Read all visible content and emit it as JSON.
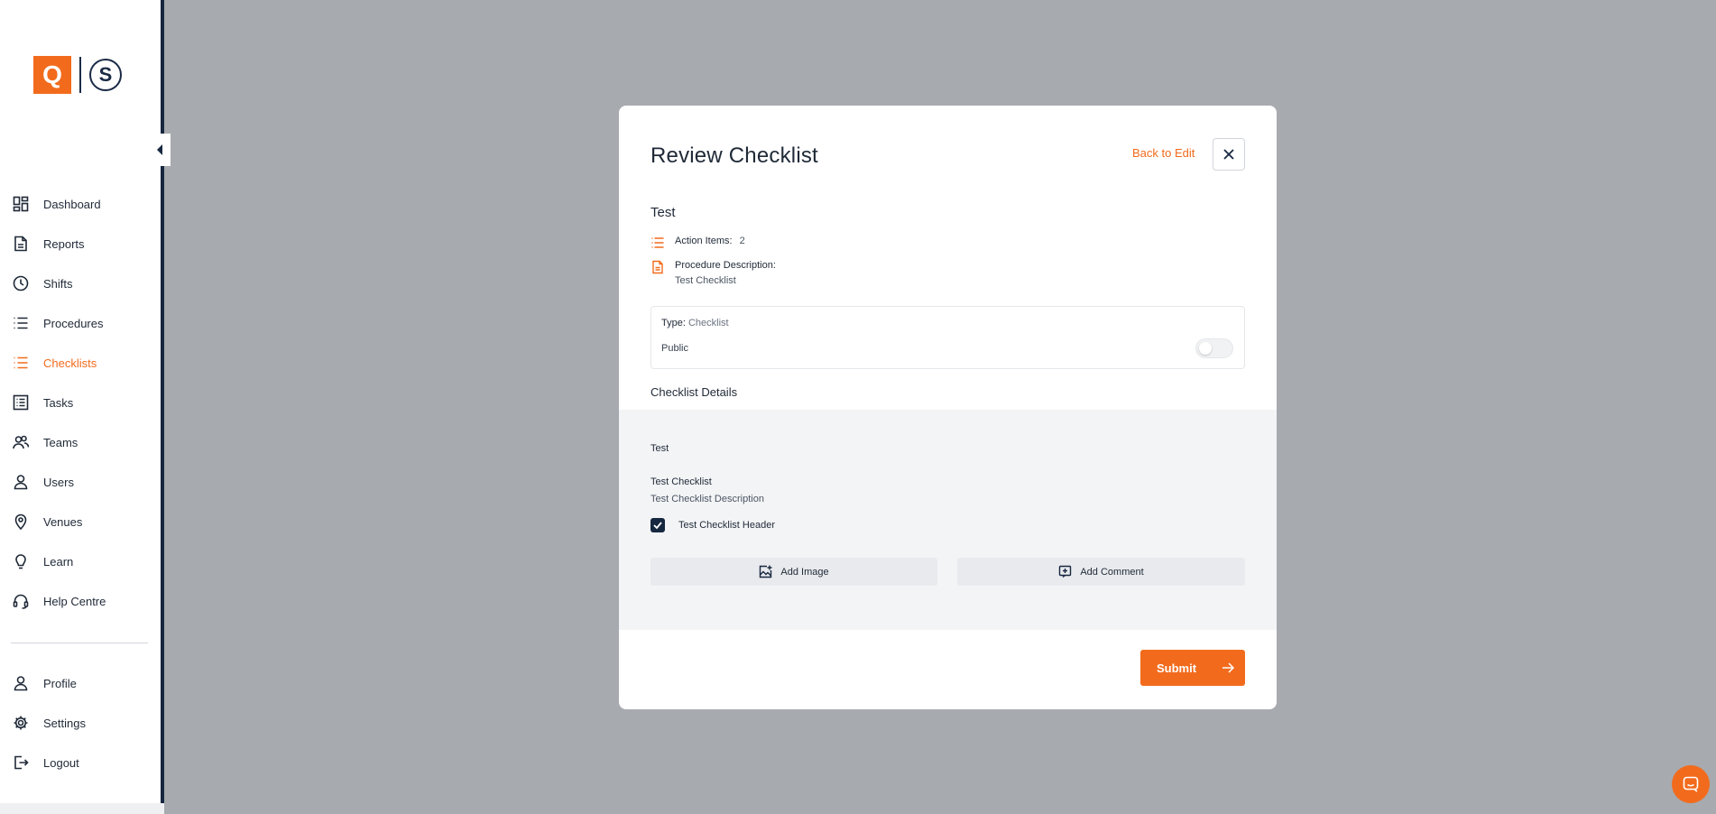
{
  "brand": {
    "logo_q": "Q",
    "logo_s": "S",
    "accent": "#f26b1d",
    "dark": "#162740"
  },
  "sidebar": {
    "items": [
      {
        "label": "Dashboard",
        "icon": "dashboard-icon"
      },
      {
        "label": "Reports",
        "icon": "document-icon"
      },
      {
        "label": "Shifts",
        "icon": "clock-icon"
      },
      {
        "label": "Procedures",
        "icon": "list-icon"
      },
      {
        "label": "Checklists",
        "icon": "checklist-icon",
        "active": true
      },
      {
        "label": "Tasks",
        "icon": "tasks-icon"
      },
      {
        "label": "Teams",
        "icon": "team-icon"
      },
      {
        "label": "Users",
        "icon": "user-icon"
      },
      {
        "label": "Venues",
        "icon": "location-pin-icon"
      },
      {
        "label": "Learn",
        "icon": "lightbulb-icon"
      },
      {
        "label": "Help Centre",
        "icon": "headset-icon"
      }
    ],
    "bottom_items": [
      {
        "label": "Profile",
        "icon": "user-icon"
      },
      {
        "label": "Settings",
        "icon": "gear-icon"
      },
      {
        "label": "Logout",
        "icon": "logout-icon"
      }
    ]
  },
  "modal": {
    "title": "Review Checklist",
    "back_label": "Back to Edit",
    "checklist_name": "Test",
    "action_items_label": "Action Items:",
    "action_items_value": "2",
    "procedure_description_label": "Procedure Description:",
    "procedure_description_value": "Test Checklist",
    "type_label": "Type:",
    "type_value": "Checklist",
    "public_label": "Public",
    "public_enabled": false,
    "details_heading": "Checklist Details",
    "details": {
      "section_title": "Test",
      "item_title": "Test Checklist",
      "item_description": "Test Checklist Description",
      "header_label": "Test Checklist Header",
      "header_checked": true,
      "add_image_label": "Add Image",
      "add_comment_label": "Add Comment"
    },
    "submit_label": "Submit"
  }
}
